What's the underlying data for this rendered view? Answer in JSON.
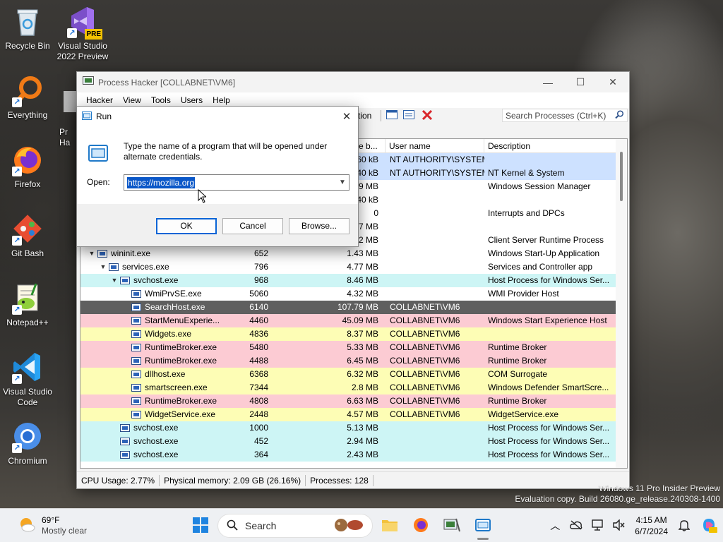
{
  "desktop": {
    "icons": [
      {
        "label": "Recycle Bin",
        "icon": "recycle-bin-icon"
      },
      {
        "label": "Visual Studio 2022 Preview",
        "icon": "visual-studio-icon",
        "badge": "PRE"
      },
      {
        "label": "Everything",
        "icon": "everything-search-icon"
      },
      {
        "label": "Firefox",
        "icon": "firefox-icon"
      },
      {
        "label": "Git Bash",
        "icon": "git-bash-icon"
      },
      {
        "label": "Notepad++",
        "icon": "notepad-plus-plus-icon"
      },
      {
        "label": "Visual Studio Code",
        "icon": "vscode-icon"
      },
      {
        "label": "Chromium",
        "icon": "chromium-icon"
      }
    ],
    "partial_icon_label": "Pr\nHa"
  },
  "process_hacker": {
    "title": "Process Hacker [COLLABNET\\VM6]",
    "menu": [
      "Hacker",
      "View",
      "Tools",
      "Users",
      "Help"
    ],
    "toolbar_partial_label": "tion",
    "search_placeholder": "Search Processes (Ctrl+K)",
    "columns": {
      "private_bytes": "ate b...",
      "user_name": "User name",
      "description": "Description"
    },
    "rows": [
      {
        "depth": 0,
        "name": "",
        "pid": "",
        "mem": "60 kB",
        "user": "NT AUTHORITY\\SYSTEM",
        "desc": "",
        "color": "sel",
        "tw": ""
      },
      {
        "depth": 0,
        "name": "",
        "pid": "",
        "mem": "40 kB",
        "user": "NT AUTHORITY\\SYSTEM",
        "desc": "NT Kernel & System",
        "color": "sel",
        "tw": ""
      },
      {
        "depth": 0,
        "name": "",
        "pid": "",
        "mem": ".19 MB",
        "user": "",
        "desc": "Windows Session Manager",
        "color": "white",
        "tw": ""
      },
      {
        "depth": 0,
        "name": "",
        "pid": "",
        "mem": "40 kB",
        "user": "",
        "desc": "",
        "color": "white",
        "tw": ""
      },
      {
        "depth": 0,
        "name": "",
        "pid": "",
        "mem": "0",
        "user": "",
        "desc": "Interrupts and DPCs",
        "color": "white",
        "tw": ""
      },
      {
        "depth": 0,
        "name": "",
        "pid": "",
        "mem": ".57 MB",
        "user": "",
        "desc": "",
        "color": "white",
        "tw": ""
      },
      {
        "depth": 0,
        "name": "",
        "pid": "",
        "mem": ".02 MB",
        "user": "",
        "desc": "Client Server Runtime Process",
        "color": "white",
        "tw": ""
      },
      {
        "depth": 0,
        "name": "wininit.exe",
        "pid": "652",
        "mem": "1.43 MB",
        "user": "",
        "desc": "Windows Start-Up Application",
        "color": "white",
        "tw": "v"
      },
      {
        "depth": 1,
        "name": "services.exe",
        "pid": "796",
        "mem": "4.77 MB",
        "user": "",
        "desc": "Services and Controller app",
        "color": "white",
        "tw": "v"
      },
      {
        "depth": 2,
        "name": "svchost.exe",
        "pid": "968",
        "mem": "8.46 MB",
        "user": "",
        "desc": "Host Process for Windows Ser...",
        "color": "blue",
        "tw": "v"
      },
      {
        "depth": 3,
        "name": "WmiPrvSE.exe",
        "pid": "5060",
        "mem": "4.32 MB",
        "user": "",
        "desc": "WMI Provider Host",
        "color": "white",
        "tw": ""
      },
      {
        "depth": 3,
        "name": "SearchHost.exe",
        "pid": "6140",
        "mem": "107.79 MB",
        "user": "COLLABNET\\VM6",
        "desc": "",
        "color": "dark",
        "tw": ""
      },
      {
        "depth": 3,
        "name": "StartMenuExperie...",
        "pid": "4460",
        "mem": "45.09 MB",
        "user": "COLLABNET\\VM6",
        "desc": "Windows Start Experience Host",
        "color": "pink",
        "tw": ""
      },
      {
        "depth": 3,
        "name": "Widgets.exe",
        "pid": "4836",
        "mem": "8.37 MB",
        "user": "COLLABNET\\VM6",
        "desc": "",
        "color": "yellow",
        "tw": ""
      },
      {
        "depth": 3,
        "name": "RuntimeBroker.exe",
        "pid": "5480",
        "mem": "5.33 MB",
        "user": "COLLABNET\\VM6",
        "desc": "Runtime Broker",
        "color": "pink",
        "tw": ""
      },
      {
        "depth": 3,
        "name": "RuntimeBroker.exe",
        "pid": "4488",
        "mem": "6.45 MB",
        "user": "COLLABNET\\VM6",
        "desc": "Runtime Broker",
        "color": "pink",
        "tw": ""
      },
      {
        "depth": 3,
        "name": "dllhost.exe",
        "pid": "6368",
        "mem": "6.32 MB",
        "user": "COLLABNET\\VM6",
        "desc": "COM Surrogate",
        "color": "yellow",
        "tw": ""
      },
      {
        "depth": 3,
        "name": "smartscreen.exe",
        "pid": "7344",
        "mem": "2.8 MB",
        "user": "COLLABNET\\VM6",
        "desc": "Windows Defender SmartScre...",
        "color": "yellow",
        "tw": ""
      },
      {
        "depth": 3,
        "name": "RuntimeBroker.exe",
        "pid": "4808",
        "mem": "6.63 MB",
        "user": "COLLABNET\\VM6",
        "desc": "Runtime Broker",
        "color": "pink",
        "tw": ""
      },
      {
        "depth": 3,
        "name": "WidgetService.exe",
        "pid": "2448",
        "mem": "4.57 MB",
        "user": "COLLABNET\\VM6",
        "desc": "WidgetService.exe",
        "color": "yellow",
        "tw": ""
      },
      {
        "depth": 2,
        "name": "svchost.exe",
        "pid": "1000",
        "mem": "5.13 MB",
        "user": "",
        "desc": "Host Process for Windows Ser...",
        "color": "blue",
        "tw": ""
      },
      {
        "depth": 2,
        "name": "svchost.exe",
        "pid": "452",
        "mem": "2.94 MB",
        "user": "",
        "desc": "Host Process for Windows Ser...",
        "color": "blue",
        "tw": ""
      },
      {
        "depth": 2,
        "name": "svchost.exe",
        "pid": "364",
        "mem": "2.43 MB",
        "user": "",
        "desc": "Host Process for Windows Ser...",
        "color": "blue",
        "tw": ""
      }
    ],
    "status": {
      "cpu": "CPU Usage: 2.77%",
      "memory": "Physical memory: 2.09 GB (26.16%)",
      "processes": "Processes: 128"
    }
  },
  "run_dialog": {
    "title": "Run",
    "message": "Type the name of a program that will be opened under alternate credentials.",
    "open_label": "Open:",
    "open_value": "https://mozilla.org",
    "ok_label": "OK",
    "cancel_label": "Cancel",
    "browse_label": "Browse..."
  },
  "watermark": {
    "line1": "Windows 11 Pro Insider Preview",
    "line2": "Evaluation copy. Build 26080.ge_release.240308-1400"
  },
  "taskbar": {
    "weather_temp": "69°F",
    "weather_desc": "Mostly clear",
    "search_label": "Search",
    "time": "4:15 AM",
    "date": "6/7/2024"
  },
  "colors": {
    "row_selected": "#cde1ff",
    "row_service": "#cdf5f5",
    "row_user": "#fdfdb5",
    "row_immersive": "#fccbd3",
    "row_suspended": "#5f5f5f",
    "accent": "#0a57c8"
  }
}
